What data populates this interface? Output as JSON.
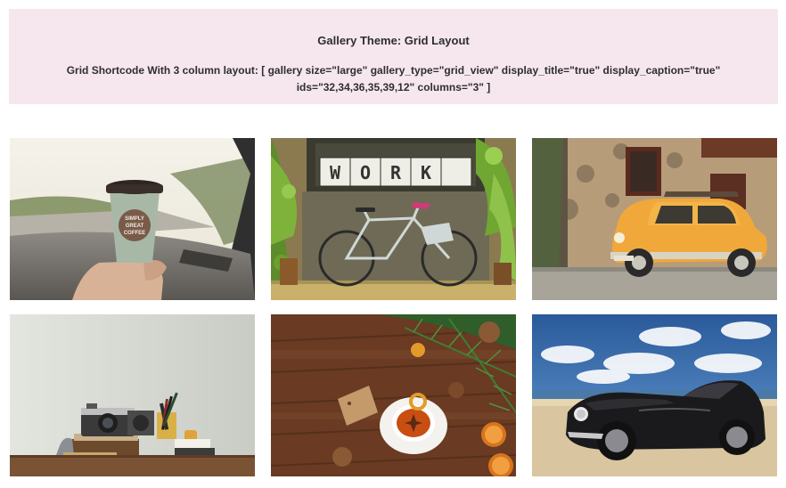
{
  "notice": {
    "title": "Gallery Theme: Grid Layout",
    "body": "Grid Shortcode With 3 column layout: [ gallery size=\"large\" gallery_type=\"grid_view\" display_title=\"true\" display_caption=\"true\" ids=\"32,34,36,35,39,12\" columns=\"3\" ]"
  },
  "gallery": {
    "columns": 3,
    "images": [
      {
        "subject": "coffee-cup-in-car",
        "cup_text": [
          "SIMPLY",
          "GREAT",
          "COFFEE"
        ]
      },
      {
        "subject": "bicycle-work-sign",
        "sign_text": "WORK"
      },
      {
        "subject": "yellow-vintage-car"
      },
      {
        "subject": "camera-desk"
      },
      {
        "subject": "tea-on-wood"
      },
      {
        "subject": "black-sports-car"
      }
    ]
  },
  "colors": {
    "notice_bg": "#f6e7ee",
    "text": "#2e2e2e"
  }
}
